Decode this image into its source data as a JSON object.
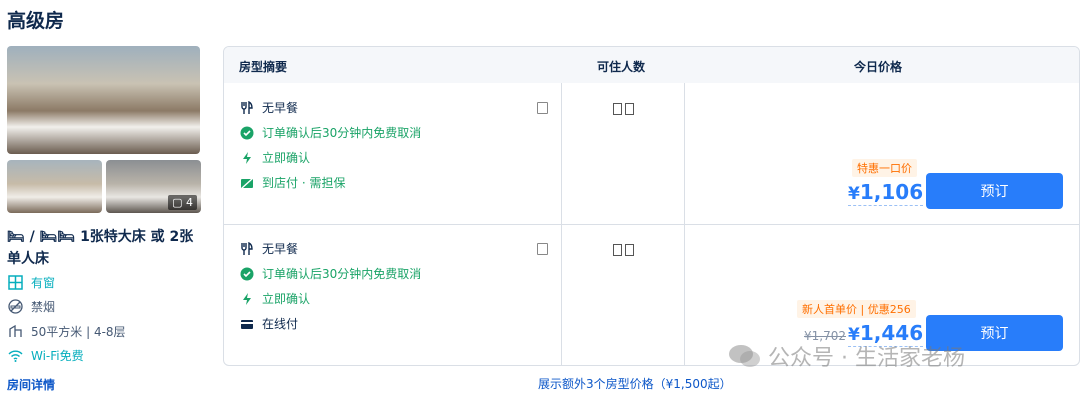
{
  "room": {
    "title": "高级房",
    "photo_count": "4",
    "bed_text": "1张特大床 或 2张单人床",
    "features": [
      {
        "icon": "window-icon",
        "label": "有窗"
      },
      {
        "icon": "no-smoking-icon",
        "label": "禁烟"
      },
      {
        "icon": "area-icon",
        "label": "50平方米 | 4-8层"
      },
      {
        "icon": "wifi-icon",
        "label": "Wi-Fi免费"
      }
    ],
    "detail_link": "房间详情"
  },
  "table": {
    "headers": [
      "房型摘要",
      "可住人数",
      "今日价格"
    ],
    "rows": [
      {
        "policies": [
          {
            "icon": "fork-knife-icon",
            "text": "无早餐"
          },
          {
            "icon": "check-circle-icon",
            "text": "订单确认后30分钟内免费取消"
          },
          {
            "icon": "lightning-icon",
            "text": "立即确认"
          },
          {
            "icon": "pay-at-hotel-icon",
            "text": "到店付 · 需担保"
          }
        ],
        "promo": "特惠一口价",
        "currency": "¥",
        "price": "1,106",
        "book_label": "预订"
      },
      {
        "policies": [
          {
            "icon": "fork-knife-icon",
            "text": "无早餐"
          },
          {
            "icon": "check-circle-icon",
            "text": "订单确认后30分钟内免费取消"
          },
          {
            "icon": "lightning-icon",
            "text": "立即确认"
          },
          {
            "icon": "card-icon",
            "text": "在线付"
          }
        ],
        "promo": "新人首单价 | 优惠256",
        "original_price": "¥1,702",
        "currency": "¥",
        "price": "1,446",
        "book_label": "预订"
      }
    ],
    "more_link": "展示额外3个房型价格（¥1,500起）"
  },
  "watermark": "公众号 · 生活家老杨",
  "colors": {
    "accent": "#287dfa",
    "green": "#06aebd",
    "promo": "#ff6f00"
  }
}
